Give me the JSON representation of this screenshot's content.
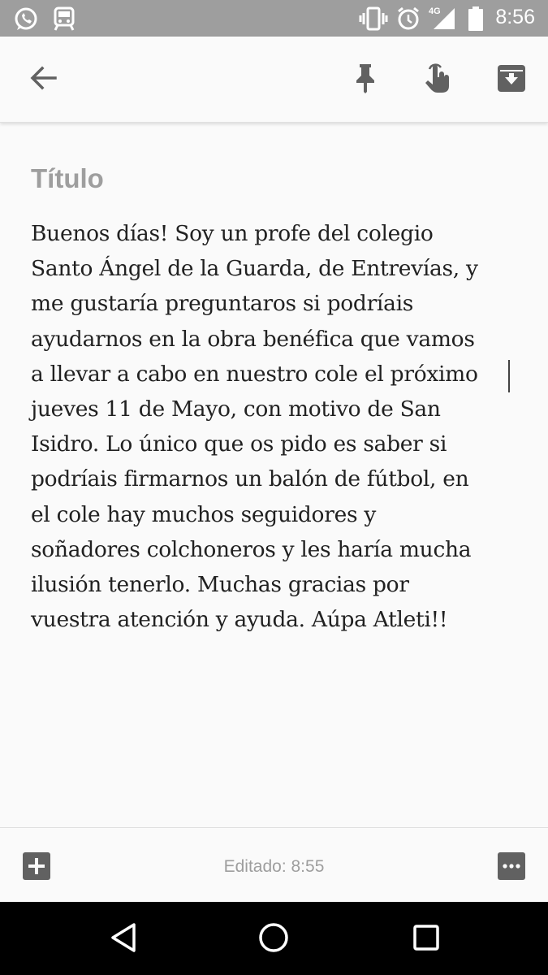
{
  "status_bar": {
    "time": "8:56",
    "network": "4G",
    "icons": [
      "whatsapp-icon",
      "train-icon",
      "vibrate-icon",
      "alarm-icon",
      "signal-icon",
      "battery-icon"
    ]
  },
  "toolbar": {
    "back_icon": "arrow-left-icon",
    "pin_icon": "pin-icon",
    "reminder_icon": "hand-pointer-icon",
    "archive_icon": "archive-icon"
  },
  "note": {
    "title_placeholder": "Título",
    "body": "Buenos días! Soy un profe del colegio Santo Ángel de la Guarda, de Entrevías, y me gustaría preguntaros si podríais ayudarnos en la obra benéfica que vamos a llevar a cabo en nuestro cole el próximo jueves 11 de Mayo, con motivo de San Isidro. Lo único que os pido es saber si podríais firmarnos un balón de fútbol, en el cole hay muchos seguidores y soñadores colchoneros y les haría mucha ilusión tenerlo. Muchas gracias por vuestra atención y ayuda. Aúpa Atleti!!",
    "lines": [
      "Buenos días! Soy un profe del colegio",
      "Santo Ángel de la Guarda, de Entrevías, y",
      "me gustaría preguntaros si podríais",
      "ayudarnos en la obra benéfica que vamos",
      "a llevar a cabo en nuestro cole el próximo",
      "jueves 11 de Mayo, con motivo de San",
      "Isidro. Lo único que os pido es saber si",
      "podríais firmarnos un balón de fútbol, en",
      "el cole hay muchos seguidores y",
      "soñadores colchoneros y les haría mucha",
      "ilusión tenerlo. Muchas gracias por",
      "vuestra atención y ayuda. Aúpa Atleti!!"
    ]
  },
  "bottom_bar": {
    "edited_label": "Editado: 8:55",
    "add_icon": "add-box-icon",
    "more_icon": "more-horizontal-icon"
  },
  "nav_bar": {
    "back_icon": "triangle-back-icon",
    "home_icon": "circle-home-icon",
    "recents_icon": "square-recents-icon"
  },
  "colors": {
    "status_bar": "#9e9e9e",
    "background": "#fafafa",
    "icon": "#616161",
    "text": "#212121",
    "muted": "#9e9e9e",
    "nav_bar": "#000000"
  }
}
